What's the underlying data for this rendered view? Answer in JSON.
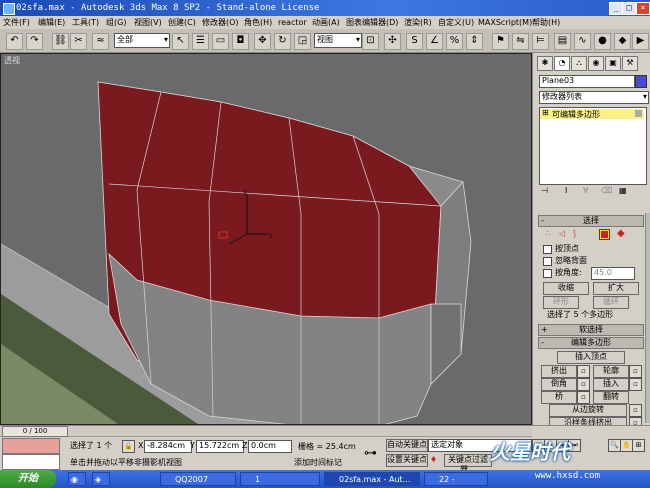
{
  "window": {
    "title": "02sfa.max - Autodesk 3ds Max 8 SP2  - Stand-alone License"
  },
  "menu": [
    "文件(F)",
    "编辑(E)",
    "工具(T)",
    "组(G)",
    "视图(V)",
    "创建(C)",
    "修改器(O)",
    "角色(H)",
    "reactor",
    "动画(A)",
    "图表编辑器(D)",
    "渲染(R)",
    "自定义(U)",
    "MAXScript(M)",
    "帮助(H)"
  ],
  "toolbar": {
    "selection_filter": "全部",
    "ref_coord": "视图"
  },
  "viewport": {
    "label": "透视"
  },
  "panel": {
    "object_name": "Plane03",
    "modifier_list": "修改器列表",
    "stack_item": "可编辑多边形",
    "selection_rollout": "选择",
    "by_vertex": "按顶点",
    "ignore_backfacing": "忽略背面",
    "by_angle": "按角度:",
    "angle_value": "45.0",
    "shrink": "收缩",
    "grow": "扩大",
    "ring": "环形",
    "loop": "循环",
    "selection_status": "选择了 5 个多边形",
    "soft_selection": "软选择",
    "edit_polygons": "编辑多边形",
    "insert_vertex": "插入顶点",
    "extrude": "挤出",
    "outline": "轮廓",
    "bevel": "倒角",
    "inset": "插入",
    "bridge": "桥",
    "flip": "翻转",
    "hinge_from_edge": "从边旋转",
    "extrude_along_spline": "沿样条线挤出"
  },
  "status": {
    "timeline": "0 / 100",
    "selected": "选择了 1 个",
    "x_label": "X",
    "x": "-8.284cm",
    "y_label": "Y",
    "y": "15.722cm",
    "z_label": "Z",
    "z": "0.0cm",
    "grid": "栅格 = 25.4cm",
    "auto_key": "自动关键点",
    "selected_set": "选定对象",
    "set_key": "设置关键点",
    "key_filters": "关键点过滤器...",
    "prompt": "单击并拖动以平移非摄影机视图",
    "add_time_tag": "添加时间标记"
  },
  "taskbar": {
    "start": "开始",
    "items": [
      "QQ2007",
      "1",
      "02sfa.max - Aut...",
      "22 - "
    ]
  },
  "watermark": {
    "brand": "火星时代",
    "url": "www.hxsd.com"
  }
}
